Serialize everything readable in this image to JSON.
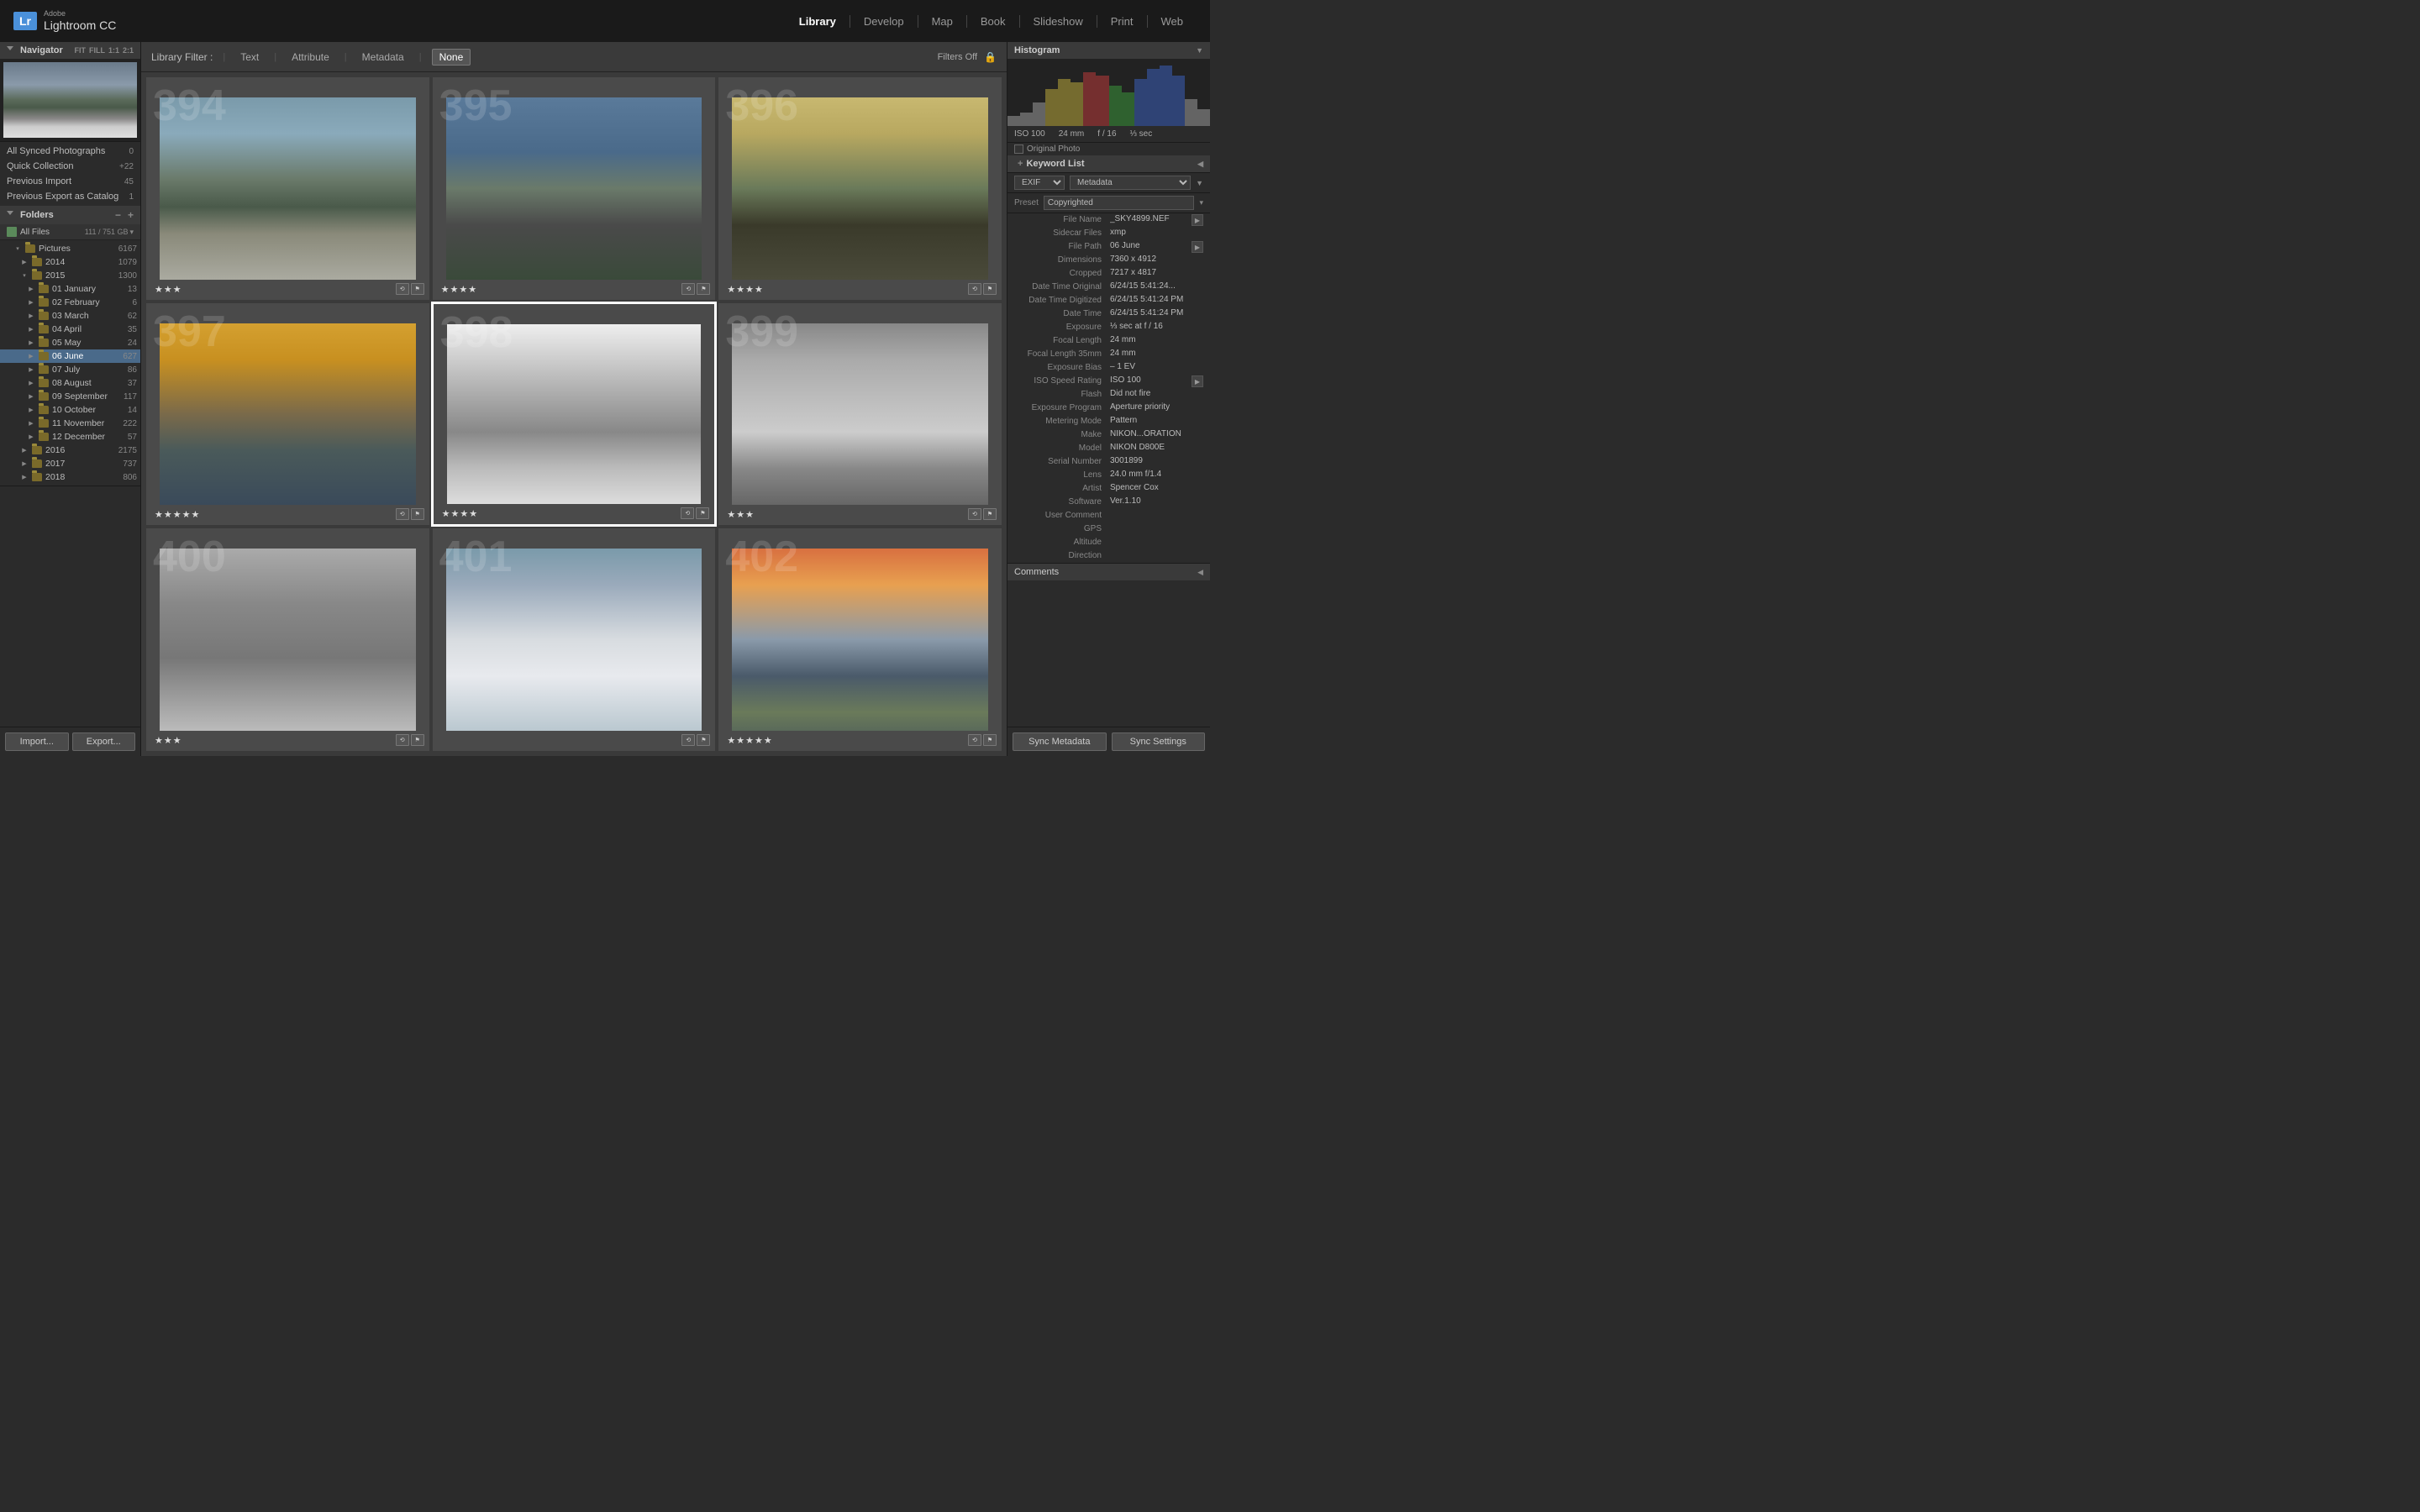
{
  "app": {
    "logo": "Lr",
    "adobe": "Adobe",
    "name": "Lightroom CC"
  },
  "topnav": {
    "items": [
      {
        "label": "Library",
        "active": true
      },
      {
        "label": "Develop",
        "active": false
      },
      {
        "label": "Map",
        "active": false
      },
      {
        "label": "Book",
        "active": false
      },
      {
        "label": "Slideshow",
        "active": false
      },
      {
        "label": "Print",
        "active": false
      },
      {
        "label": "Web",
        "active": false
      }
    ]
  },
  "navigator": {
    "title": "Navigator",
    "fit": "FIT",
    "fill": "FILL",
    "one": "1:1",
    "two": "2:1"
  },
  "catalog": {
    "items": [
      {
        "label": "All Synced Photographs",
        "count": "0"
      },
      {
        "label": "Quick Collection",
        "count": "22",
        "plus": true
      },
      {
        "label": "Previous Import",
        "count": "45"
      },
      {
        "label": "Previous Export as Catalog",
        "count": "1"
      }
    ]
  },
  "folders": {
    "title": "Folders",
    "disk": {
      "label": "All Files",
      "count": "111 / 751 GB"
    },
    "tree": [
      {
        "name": "Pictures",
        "count": "6167",
        "indent": 1,
        "expanded": true
      },
      {
        "name": "2014",
        "count": "1079",
        "indent": 2,
        "expanded": false
      },
      {
        "name": "2015",
        "count": "1300",
        "indent": 2,
        "expanded": true
      },
      {
        "name": "01 January",
        "count": "13",
        "indent": 3,
        "expanded": false
      },
      {
        "name": "02 February",
        "count": "6",
        "indent": 3,
        "expanded": false
      },
      {
        "name": "03 March",
        "count": "62",
        "indent": 3,
        "expanded": false
      },
      {
        "name": "04 April",
        "count": "35",
        "indent": 3,
        "expanded": false
      },
      {
        "name": "05 May",
        "count": "24",
        "indent": 3,
        "expanded": false
      },
      {
        "name": "06 June",
        "count": "627",
        "indent": 3,
        "expanded": false,
        "active": true
      },
      {
        "name": "07 July",
        "count": "86",
        "indent": 3,
        "expanded": false
      },
      {
        "name": "08 August",
        "count": "37",
        "indent": 3,
        "expanded": false
      },
      {
        "name": "09 September",
        "count": "117",
        "indent": 3,
        "expanded": false
      },
      {
        "name": "10 October",
        "count": "14",
        "indent": 3,
        "expanded": false
      },
      {
        "name": "11 November",
        "count": "222",
        "indent": 3,
        "expanded": false
      },
      {
        "name": "12 December",
        "count": "57",
        "indent": 3,
        "expanded": false
      },
      {
        "name": "2016",
        "count": "2175",
        "indent": 2,
        "expanded": false
      },
      {
        "name": "2017",
        "count": "737",
        "indent": 2,
        "expanded": false
      },
      {
        "name": "2018",
        "count": "806",
        "indent": 2,
        "expanded": false
      }
    ]
  },
  "bottom_buttons": {
    "import": "Import...",
    "export": "Export..."
  },
  "filter": {
    "label": "Library Filter :",
    "text": "Text",
    "attribute": "Attribute",
    "metadata": "Metadata",
    "none": "None",
    "filters_off": "Filters Off",
    "lock": "🔒"
  },
  "photos": [
    {
      "number": "394",
      "stars": 3,
      "selected": false,
      "bg": "photo-iceland-1"
    },
    {
      "number": "395",
      "stars": 4,
      "selected": false,
      "bg": "photo-iceland-2"
    },
    {
      "number": "396",
      "stars": 4,
      "selected": false,
      "bg": "photo-iceland-3"
    },
    {
      "number": "397",
      "stars": 5,
      "selected": false,
      "bg": "photo-iceland-4"
    },
    {
      "number": "398",
      "stars": 4,
      "selected": true,
      "bg": "photo-bw-1"
    },
    {
      "number": "399",
      "stars": 3,
      "selected": false,
      "bg": "photo-bw-2"
    },
    {
      "number": "400",
      "stars": 3,
      "selected": false,
      "bg": "photo-bw-2"
    },
    {
      "number": "401",
      "stars": 0,
      "selected": false,
      "bg": "photo-coast-1"
    },
    {
      "number": "402",
      "stars": 5,
      "selected": false,
      "bg": "photo-sunset-1"
    }
  ],
  "histogram": {
    "title": "Histogram",
    "iso": "ISO 100",
    "mm": "24 mm",
    "aperture": "f / 16",
    "shutter": "⅓ sec",
    "orig_photo": "Original Photo"
  },
  "keyword": {
    "title": "Keyword List",
    "plus": "+"
  },
  "metadata": {
    "title": "Metadata",
    "exif": "EXIF",
    "preset_label": "Preset",
    "preset_value": "Copyrighted",
    "fields": [
      {
        "key": "File Name",
        "val": "_SKY4899.NEF",
        "has_btn": true
      },
      {
        "key": "Sidecar Files",
        "val": "xmp",
        "has_btn": false
      },
      {
        "key": "File Path",
        "val": "06 June",
        "has_btn": true
      },
      {
        "key": "Dimensions",
        "val": "7360 x 4912",
        "has_btn": false
      },
      {
        "key": "Cropped",
        "val": "7217 x 4817",
        "has_btn": false
      },
      {
        "key": "Date Time Original",
        "val": "6/24/15 5:41:24...",
        "has_btn": false
      },
      {
        "key": "Date Time Digitized",
        "val": "6/24/15 5:41:24 PM",
        "has_btn": false
      },
      {
        "key": "Date Time",
        "val": "6/24/15 5:41:24 PM",
        "has_btn": false
      },
      {
        "key": "Exposure",
        "val": "⅓ sec at f / 16",
        "has_btn": false
      },
      {
        "key": "Focal Length",
        "val": "24 mm",
        "has_btn": false
      },
      {
        "key": "Focal Length 35mm",
        "val": "24 mm",
        "has_btn": false
      },
      {
        "key": "Exposure Bias",
        "val": "– 1 EV",
        "has_btn": false
      },
      {
        "key": "ISO Speed Rating",
        "val": "ISO 100",
        "has_btn": true
      },
      {
        "key": "Flash",
        "val": "Did not fire",
        "has_btn": false
      },
      {
        "key": "Exposure Program",
        "val": "Aperture priority",
        "has_btn": false
      },
      {
        "key": "Metering Mode",
        "val": "Pattern",
        "has_btn": false
      },
      {
        "key": "Make",
        "val": "NIKON...ORATION",
        "has_btn": false
      },
      {
        "key": "Model",
        "val": "NIKON D800E",
        "has_btn": false
      },
      {
        "key": "Serial Number",
        "val": "3001899",
        "has_btn": false
      },
      {
        "key": "Lens",
        "val": "24.0 mm f/1.4",
        "has_btn": false
      },
      {
        "key": "Artist",
        "val": "Spencer Cox",
        "has_btn": false
      },
      {
        "key": "Software",
        "val": "Ver.1.10",
        "has_btn": false
      },
      {
        "key": "User Comment",
        "val": "",
        "has_btn": false
      },
      {
        "key": "GPS",
        "val": "",
        "has_btn": false
      },
      {
        "key": "Altitude",
        "val": "",
        "has_btn": false
      },
      {
        "key": "Direction",
        "val": "",
        "has_btn": false
      }
    ]
  },
  "sync_buttons": {
    "sync_meta": "Sync Metadata",
    "sync_settings": "Sync Settings"
  },
  "comments": "Comments"
}
